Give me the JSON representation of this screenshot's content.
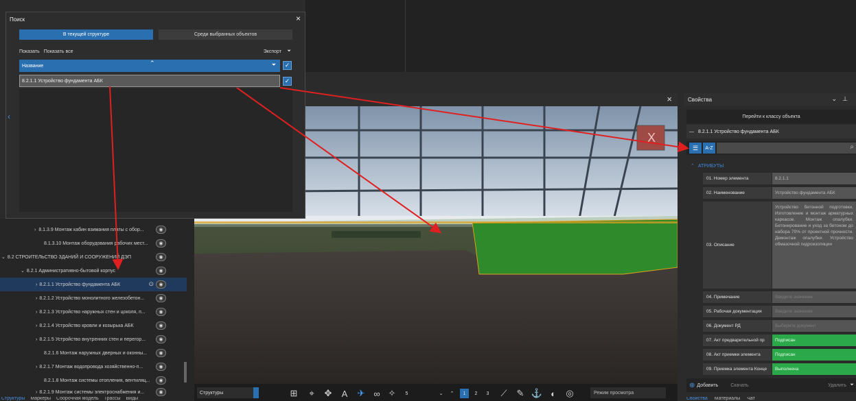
{
  "search": {
    "title": "Поиск",
    "close": "×",
    "tab_current": "В текущей структуре",
    "tab_selected": "Среди выбранных объектов",
    "show": "Показать",
    "show_all": "Показать все",
    "export": "Экспорт",
    "column_name": "Название",
    "result": "8.2.1.1 Устройство фундамента АБК"
  },
  "viewport": {
    "close": "×",
    "bar_label": "Структуры",
    "zoom_value": "5",
    "pages": [
      "1",
      "2",
      "3"
    ],
    "mode": "Режим просмотра"
  },
  "tree": {
    "rows": [
      {
        "label": "8.1.3.9 Монтаж кабин взимания платы с обор...",
        "indent": 50
      },
      {
        "label": "8.1.3.10 Монтаж оборудования рабочих мест...",
        "indent": 64
      },
      {
        "label": "8.2 СТРОИТЕЛЬСТВО ЗДАНИЙ И СООРУЖЕНИЙ ДЭП",
        "indent": 2
      },
      {
        "label": "8.2.1 Административно-бытовой корпус",
        "indent": 30
      },
      {
        "label": "8.2.1.1 Устройство фундамента АБК",
        "indent": 58
      },
      {
        "label": "8.2.1.2 Устройство монолитного железобетон...",
        "indent": 58
      },
      {
        "label": "8.2.1.3 Устройство наружных стен и цоколя, п...",
        "indent": 58
      },
      {
        "label": "8.2.1.4 Устройство кровли и козырька АБК",
        "indent": 58
      },
      {
        "label": "8.2.1.5 Устройство внутренних стен и перегор...",
        "indent": 58
      },
      {
        "label": "8.2.1.6 Монтаж наружных дверных и оконны...",
        "indent": 64
      },
      {
        "label": "8.2.1.7 Монтаж водопровода хозяйственно-п...",
        "indent": 58
      },
      {
        "label": "8.2.1.8 Монтаж системы отопления, вентиляц...",
        "indent": 64
      },
      {
        "label": "8.2.1.9 Монтаж системы электроснабжения и...",
        "indent": 58
      }
    ],
    "bottom_tabs": [
      "Структуры",
      "Маркеры",
      "Сборочная модель",
      "Трассы",
      "Виды"
    ]
  },
  "props": {
    "title": "Свойства",
    "goto_class": "Перейти к классу объекта",
    "element": "8.2.1.1 Устройство фундамента АБК",
    "az": "A-Z",
    "section": "АТРИБУТЫ",
    "rows": [
      {
        "k": "01. Номер элемента",
        "v": "8.2.1.1",
        "style": ""
      },
      {
        "k": "02. Наименование",
        "v": "Устройство фундамента АБК",
        "style": ""
      },
      {
        "k": "03. Описание",
        "v": "Устройство бетонной подготовки. Изготовление и монтаж арматурных каркасов. Монтаж опалубки. Бетонирование и уход за бетоном до набора 70% от проектной прочности. Демонтаж опалубки. Устройство обмазочной гидроизоляции",
        "style": "desc"
      },
      {
        "k": "04. Примечание",
        "v": "Введите значение",
        "style": "ph"
      },
      {
        "k": "05. Рабочая документация",
        "v": "Введите значение",
        "style": "ph"
      },
      {
        "k": "06. Документ РД",
        "v": "Выберите документ",
        "style": "ph"
      },
      {
        "k": "07. Акт предварительной пр",
        "v": "Подписан",
        "style": "green"
      },
      {
        "k": "08. Акт приемки элемента",
        "v": "Подписан",
        "style": "green"
      },
      {
        "k": "09. Приемка элемента Конце",
        "v": "Выполнена",
        "style": "green"
      }
    ],
    "add": "Добавить",
    "copy": "Скачать",
    "delete": "Удалить",
    "bottom_tabs": [
      "Свойства",
      "Материалы",
      "Чат"
    ]
  },
  "colors": {
    "accent": "#2a6fb0",
    "green": "#2aa84a",
    "arrow": "#e02020"
  }
}
